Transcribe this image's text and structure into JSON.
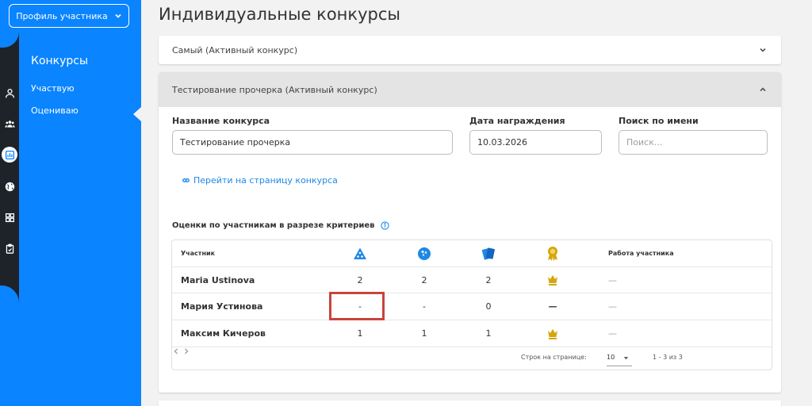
{
  "sidebar": {
    "profile_label": "Профиль участника",
    "title": "Конкурсы",
    "links": [
      "Участвую",
      "Оцениваю"
    ]
  },
  "rail_icons": [
    "user-icon",
    "team-icon",
    "chart-icon",
    "globe-icon",
    "dashboard-icon",
    "clipboard-icon"
  ],
  "page_title": "Индивидуальные конкурсы",
  "accordion1": {
    "title": "Самый (Активный конкурс)"
  },
  "accordion2": {
    "title": "Тестирование прочерка (Активный конкурс)",
    "fields": {
      "name_label": "Название конкурса",
      "name_value": "Тестирование прочерка",
      "date_label": "Дата награждения",
      "date_value": "10.03.2026",
      "search_label": "Поиск по имени",
      "search_placeholder": "Поиск..."
    },
    "link_text": "Перейти на страницу конкурса",
    "section_title": "Оценки по участникам в разрезе критериев"
  },
  "table": {
    "header_participant": "Участник",
    "header_work": "Работа участника",
    "criteria_icons": [
      "triangle-icon",
      "ball-icon",
      "cards-icon",
      "medal-icon"
    ],
    "rows": [
      {
        "name": "Maria Ustinova",
        "c1": "2",
        "c2": "2",
        "c3": "2",
        "award": "crown",
        "work": "—"
      },
      {
        "name": "Мария Устинова",
        "c1": "-",
        "c2": "-",
        "c3": "0",
        "award": "—",
        "work": "—"
      },
      {
        "name": "Максим Кичеров",
        "c1": "1",
        "c2": "1",
        "c3": "1",
        "award": "crown",
        "work": "—"
      }
    ],
    "rows_per_page_label": "Строк на странице:",
    "rows_per_page_value": "10",
    "range_text": "1 - 3 из 3"
  },
  "colors": {
    "accent": "#0a84ff",
    "highlight": "#c9443c",
    "gold": "#d4a60b",
    "link": "#1e88e5"
  }
}
